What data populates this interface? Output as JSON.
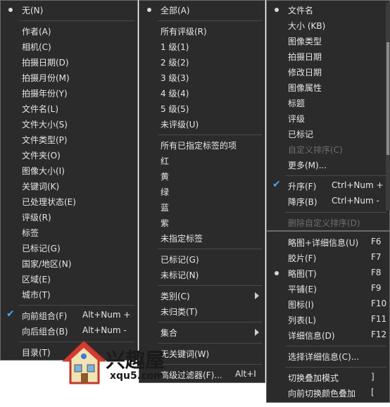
{
  "menu1": {
    "items": [
      {
        "label": "无(N)",
        "mark": "dot"
      },
      {
        "sep": true
      },
      {
        "label": "作者(A)"
      },
      {
        "label": "相机(C)"
      },
      {
        "label": "拍摄日期(D)"
      },
      {
        "label": "拍摄月份(M)"
      },
      {
        "label": "拍摄年份(Y)"
      },
      {
        "label": "文件名(L)"
      },
      {
        "label": "文件大小(S)"
      },
      {
        "label": "文件类型(P)"
      },
      {
        "label": "文件夹(O)"
      },
      {
        "label": "图像大小(I)"
      },
      {
        "label": "关键词(K)"
      },
      {
        "label": "已处理状态(E)"
      },
      {
        "label": "评级(R)"
      },
      {
        "label": "标签"
      },
      {
        "label": "已标记(G)"
      },
      {
        "label": "国家/地区(N)"
      },
      {
        "label": "区域(E)"
      },
      {
        "label": "城市(T)"
      },
      {
        "sep": true
      },
      {
        "label": "向前组合(F)",
        "shortcut": "Alt+Num +",
        "mark": "check"
      },
      {
        "label": "向后组合(B)",
        "shortcut": "Alt+Num -"
      },
      {
        "sep": true
      },
      {
        "label": "目录(T)"
      }
    ]
  },
  "menu2": {
    "items": [
      {
        "label": "全部(A)",
        "mark": "dot"
      },
      {
        "sep": true
      },
      {
        "label": "所有评级(R)"
      },
      {
        "label": "1 级(1)"
      },
      {
        "label": "2 级(2)"
      },
      {
        "label": "3 级(3)"
      },
      {
        "label": "4 级(4)"
      },
      {
        "label": "5 级(5)"
      },
      {
        "label": "未评级(U)"
      },
      {
        "sep": true
      },
      {
        "label": "所有已指定标签的项"
      },
      {
        "label": "红"
      },
      {
        "label": "黄"
      },
      {
        "label": "绿"
      },
      {
        "label": "蓝"
      },
      {
        "label": "紫"
      },
      {
        "label": "未指定标签"
      },
      {
        "sep": true
      },
      {
        "label": "已标记(G)"
      },
      {
        "label": "未标记(N)"
      },
      {
        "sep": true
      },
      {
        "label": "类别(C)",
        "submenu": true
      },
      {
        "label": "未归类(T)"
      },
      {
        "sep": true
      },
      {
        "label": "集合",
        "submenu": true
      },
      {
        "sep": true
      },
      {
        "label": "无关键词(W)"
      },
      {
        "sep": true
      },
      {
        "label": "高级过滤器(F)...",
        "shortcut": "Alt+I"
      }
    ]
  },
  "menu3": {
    "items": [
      {
        "label": "文件名",
        "mark": "dot"
      },
      {
        "label": "大小 (KB)"
      },
      {
        "label": "图像类型"
      },
      {
        "label": "拍摄日期"
      },
      {
        "label": "修改日期"
      },
      {
        "label": "图像属性"
      },
      {
        "label": "标题"
      },
      {
        "label": "评级"
      },
      {
        "label": "已标记"
      },
      {
        "label": "自定义排序(C)",
        "disabled": true
      },
      {
        "label": "更多(M)..."
      },
      {
        "sep": true
      },
      {
        "label": "升序(F)",
        "shortcut": "Ctrl+Num +",
        "mark": "check"
      },
      {
        "label": "降序(B)",
        "shortcut": "Ctrl+Num -"
      },
      {
        "sep": true
      },
      {
        "label": "删除自定义排序(D)",
        "disabled": true
      }
    ]
  },
  "menu4": {
    "items": [
      {
        "label": "略图+详细信息(U)",
        "shortcut": "F6"
      },
      {
        "label": "胶片(F)",
        "shortcut": "F7"
      },
      {
        "label": "略图(T)",
        "shortcut": "F8",
        "mark": "dot"
      },
      {
        "label": "平铺(E)",
        "shortcut": "F9"
      },
      {
        "label": "图标(I)",
        "shortcut": "F10"
      },
      {
        "label": "列表(L)",
        "shortcut": "F11"
      },
      {
        "label": "详细信息(D)",
        "shortcut": "F12"
      },
      {
        "sep": true
      },
      {
        "label": "选择详细信息(C)..."
      },
      {
        "sep": true
      },
      {
        "label": "切换叠加模式",
        "shortcut": "]"
      },
      {
        "label": "向前切换颜色叠加",
        "shortcut": "["
      }
    ]
  },
  "watermark": {
    "text": "兴趣屋",
    "url": "xqu5.com"
  },
  "colors": {
    "menu_bg": "#2b2b2b",
    "text": "#e6e6e6",
    "disabled": "#6e6e6e",
    "check": "#4aa3ff"
  }
}
